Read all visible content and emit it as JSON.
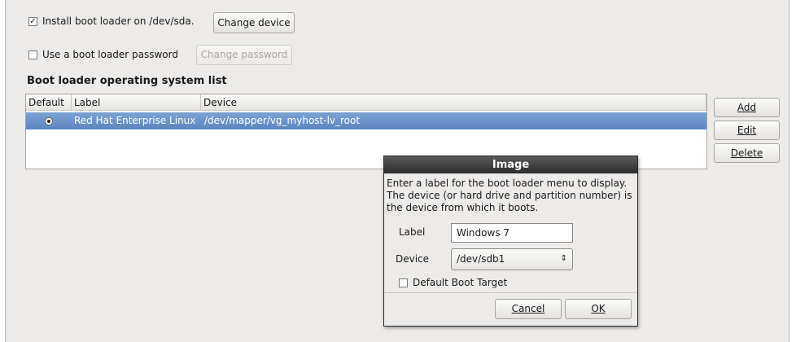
{
  "install": {
    "checked": true,
    "label": "Install boot loader on /dev/sda.",
    "change_device_label": "Change device"
  },
  "password": {
    "checked": false,
    "label": "Use a boot loader password",
    "change_password_label": "Change password"
  },
  "os_list": {
    "heading": "Boot loader operating system list",
    "columns": [
      "Default",
      "Label",
      "Device"
    ],
    "rows": [
      {
        "default": true,
        "label": "Red Hat Enterprise Linux",
        "device": "/dev/mapper/vg_myhost-lv_root",
        "selected": true
      }
    ]
  },
  "side_buttons": {
    "add": "Add",
    "edit": "Edit",
    "delete": "Delete"
  },
  "dialog": {
    "title": "Image",
    "description": "Enter a label for the boot loader menu to display. The device (or hard drive and partition number) is the device from which it boots.",
    "label_caption": "Label",
    "label_value": "Windows 7",
    "device_caption": "Device",
    "device_value": "/dev/sdb1",
    "default_target_label": "Default Boot Target",
    "default_target_checked": false,
    "cancel_label": "Cancel",
    "ok_label": "OK"
  },
  "colors": {
    "selection": "#6b8fc8",
    "window_bg": "#edebe9",
    "titlebar": "#3a3a3a"
  }
}
